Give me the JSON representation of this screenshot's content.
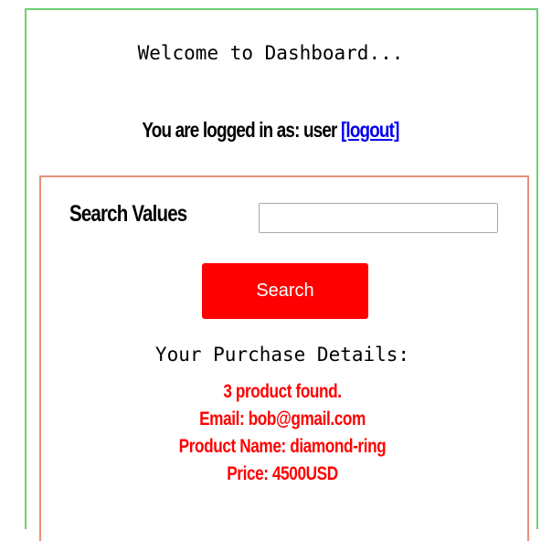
{
  "welcome_text": "Welcome to Dashboard...",
  "login": {
    "prefix": "You are logged in as: user ",
    "logout_label": "[logout]"
  },
  "search": {
    "label": "Search Values",
    "input_value": "",
    "button_label": "Search"
  },
  "purchase": {
    "title": "Your Purchase Details:",
    "lines": [
      "3 product found.",
      "Email: bob@gmail.com",
      "Product Name: diamond-ring",
      "Price: 4500USD"
    ]
  },
  "colors": {
    "outer_border": "#6fcf73",
    "inner_border": "#e8907a",
    "accent_red": "#ff0000",
    "link_blue": "#0000ee"
  }
}
